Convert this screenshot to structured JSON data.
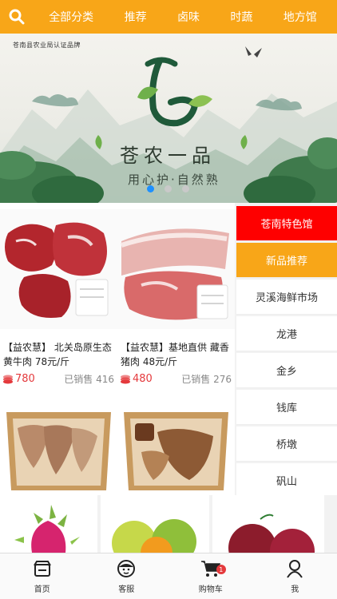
{
  "topbar": {
    "search_icon": "search-icon",
    "categories": [
      "全部分类",
      "推荐",
      "卤味",
      "时蔬",
      "地方馆"
    ]
  },
  "banner": {
    "cert_text": "苍南县农业局认证品牌",
    "brand_title": "苍农一品",
    "slogan": "用心护·自然熟",
    "active_dot": 0,
    "dot_count": 3
  },
  "products": [
    {
      "name": "【益农慧】 北关岛原生态黄牛肉 78元/斤",
      "price": "780",
      "sold": "已销售 416"
    },
    {
      "name": "【益农慧】基地直供 藏香猪肉 48元/斤",
      "price": "480",
      "sold": "已销售 276"
    },
    {
      "name": "",
      "price": "",
      "sold": ""
    },
    {
      "name": "",
      "price": "",
      "sold": ""
    }
  ],
  "sidemenu": {
    "items": [
      "苍南特色馆",
      "新品推荐",
      "灵溪海鲜市场",
      "龙港",
      "金乡",
      "钱库",
      "桥墩",
      "矾山"
    ]
  },
  "tabbar": {
    "tabs": [
      {
        "label": "首页",
        "icon": "home-store-icon"
      },
      {
        "label": "客服",
        "icon": "customer-service-icon"
      },
      {
        "label": "购物车",
        "icon": "cart-icon",
        "badge": "1"
      },
      {
        "label": "我",
        "icon": "user-icon"
      }
    ]
  },
  "colors": {
    "accent": "#f8a618",
    "red": "#fe0000",
    "price": "#e4393c"
  }
}
